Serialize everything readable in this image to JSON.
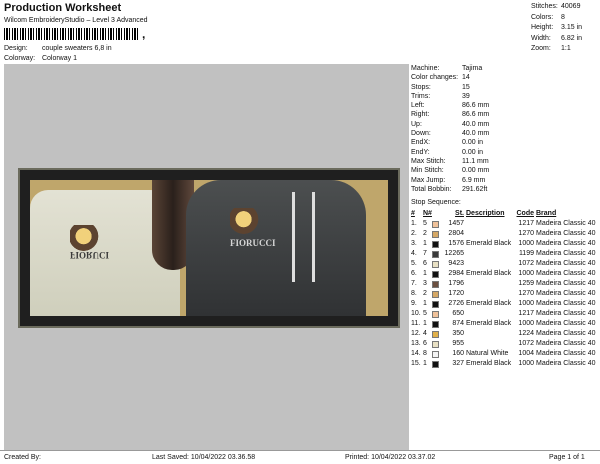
{
  "header": {
    "title": "Production Worksheet",
    "subtitle": "Wilcom EmbroideryStudio – Level 3 Advanced",
    "barcode_tail": ",",
    "design_label": "Design:",
    "design_value": "couple sweaters 6,8 in",
    "colorway_label": "Colorway:",
    "colorway_value": "Colorway 1"
  },
  "summary": [
    {
      "label": "Stitches:",
      "value": "40069"
    },
    {
      "label": "Colors:",
      "value": "8"
    },
    {
      "label": "Height:",
      "value": "3.15 in"
    },
    {
      "label": "Width:",
      "value": "6.82 in"
    },
    {
      "label": "Zoom:",
      "value": "1:1"
    }
  ],
  "stats": [
    {
      "label": "Machine:",
      "value": "Tajima"
    },
    {
      "label": "Color changes:",
      "value": "14"
    },
    {
      "label": "Stops:",
      "value": "15"
    },
    {
      "label": "Trims:",
      "value": "39"
    },
    {
      "label": "Left:",
      "value": "86.6 mm"
    },
    {
      "label": "Right:",
      "value": "86.6 mm"
    },
    {
      "label": "Up:",
      "value": "40.0 mm"
    },
    {
      "label": "Down:",
      "value": "40.0 mm"
    },
    {
      "label": "EndX:",
      "value": "0.00 in"
    },
    {
      "label": "EndY:",
      "value": "0.00 in"
    },
    {
      "label": "Max Stitch:",
      "value": "11.1 mm"
    },
    {
      "label": "Min Stitch:",
      "value": "0.00 mm"
    },
    {
      "label": "Max Jump:",
      "value": "6.9 mm"
    },
    {
      "label": "Total Bobbin:",
      "value": "291.62ft"
    }
  ],
  "stop_sequence": {
    "title": "Stop Sequence:",
    "columns": {
      "idx": "#",
      "n": "N#",
      "st": "St.",
      "desc": "Description",
      "code": "Code",
      "brand": "Brand"
    },
    "rows": [
      {
        "idx": "1.",
        "n": "5",
        "color": "#f0c29a",
        "st": "1457",
        "desc": "",
        "code": "1217",
        "brand": "Madeira Classic 40"
      },
      {
        "idx": "2.",
        "n": "2",
        "color": "#d5a866",
        "st": "2804",
        "desc": "",
        "code": "1270",
        "brand": "Madeira Classic 40"
      },
      {
        "idx": "3.",
        "n": "1",
        "color": "#111111",
        "st": "1576",
        "desc": "Emerald Black",
        "code": "1000",
        "brand": "Madeira Classic 40"
      },
      {
        "idx": "4.",
        "n": "7",
        "color": "#3a3a3a",
        "st": "12265",
        "desc": "",
        "code": "1199",
        "brand": "Madeira Classic 40"
      },
      {
        "idx": "5.",
        "n": "6",
        "color": "#e9e1c4",
        "st": "9423",
        "desc": "",
        "code": "1072",
        "brand": "Madeira Classic 40"
      },
      {
        "idx": "6.",
        "n": "1",
        "color": "#111111",
        "st": "2984",
        "desc": "Emerald Black",
        "code": "1000",
        "brand": "Madeira Classic 40"
      },
      {
        "idx": "7.",
        "n": "3",
        "color": "#6b5040",
        "st": "1796",
        "desc": "",
        "code": "1259",
        "brand": "Madeira Classic 40"
      },
      {
        "idx": "8.",
        "n": "2",
        "color": "#d5a866",
        "st": "1720",
        "desc": "",
        "code": "1270",
        "brand": "Madeira Classic 40"
      },
      {
        "idx": "9.",
        "n": "1",
        "color": "#111111",
        "st": "2726",
        "desc": "Emerald Black",
        "code": "1000",
        "brand": "Madeira Classic 40"
      },
      {
        "idx": "10.",
        "n": "5",
        "color": "#f0c29a",
        "st": "650",
        "desc": "",
        "code": "1217",
        "brand": "Madeira Classic 40"
      },
      {
        "idx": "11.",
        "n": "1",
        "color": "#111111",
        "st": "874",
        "desc": "Emerald Black",
        "code": "1000",
        "brand": "Madeira Classic 40"
      },
      {
        "idx": "12.",
        "n": "4",
        "color": "#e0b04a",
        "st": "350",
        "desc": "",
        "code": "1224",
        "brand": "Madeira Classic 40"
      },
      {
        "idx": "13.",
        "n": "6",
        "color": "#e9e1c4",
        "st": "955",
        "desc": "",
        "code": "1072",
        "brand": "Madeira Classic 40"
      },
      {
        "idx": "14.",
        "n": "8",
        "color": "#f4f4f4",
        "st": "160",
        "desc": "Natural White",
        "code": "1004",
        "brand": "Madeira Classic 40"
      },
      {
        "idx": "15.",
        "n": "1",
        "color": "#111111",
        "st": "327",
        "desc": "Emerald Black",
        "code": "1000",
        "brand": "Madeira Classic 40"
      }
    ]
  },
  "design_print": {
    "left_text": "FIORUCI",
    "right_text": "FIORUCCI"
  },
  "footer": {
    "created_by": "Created By:",
    "last_saved": "Last Saved: 10/04/2022 03.36.58",
    "printed": "Printed: 10/04/2022 03.37.02",
    "page": "Page 1 of 1"
  }
}
